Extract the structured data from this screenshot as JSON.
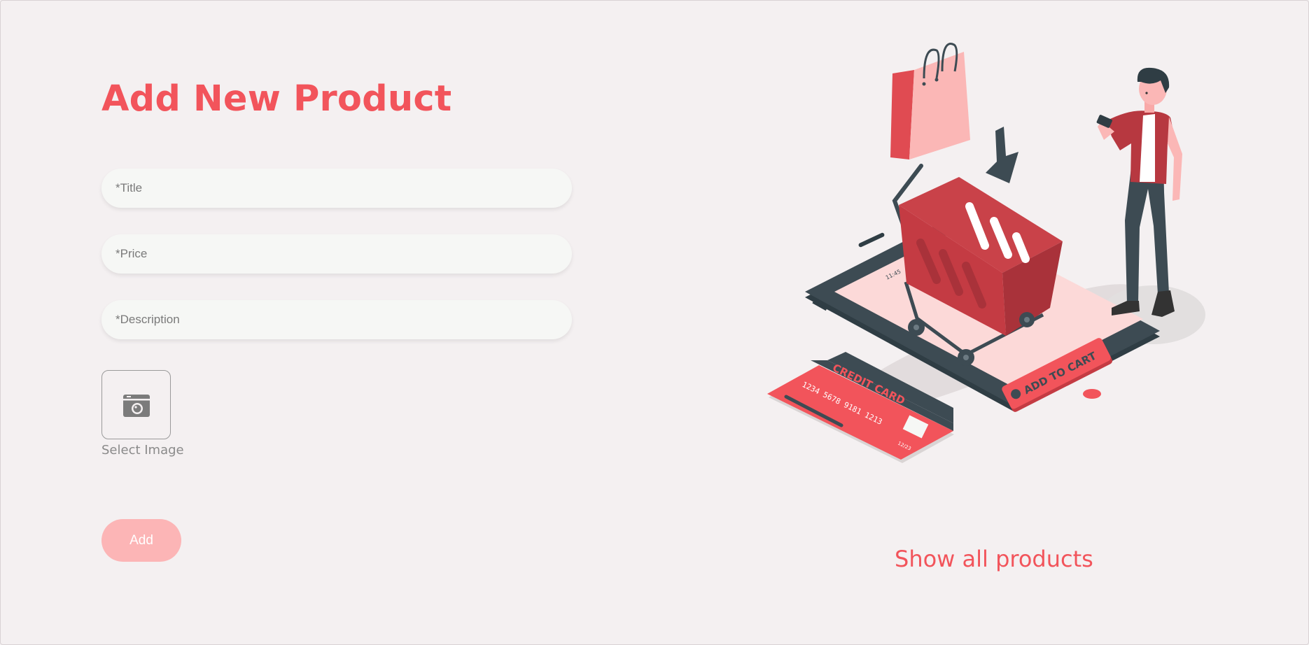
{
  "page": {
    "title": "Add New Product"
  },
  "form": {
    "title_placeholder": "*Title",
    "price_placeholder": "*Price",
    "description_placeholder": "*Description",
    "select_image_label": "Select Image",
    "add_button_label": "Add",
    "image_icon": "camera-icon"
  },
  "links": {
    "show_all_products": "Show all products"
  },
  "illustration": {
    "phone_time": "11:45",
    "cart_button_text": "ADD TO CART",
    "card_title": "CREDIT CARD",
    "card_number": "1234 5678 9181 1213",
    "card_expiry": "12/23"
  },
  "colors": {
    "accent": "#f2545b",
    "button_bg": "#fcb5b6",
    "page_bg": "#f4f0f1",
    "input_bg": "#f6f7f5",
    "dark": "#3d4b53"
  }
}
